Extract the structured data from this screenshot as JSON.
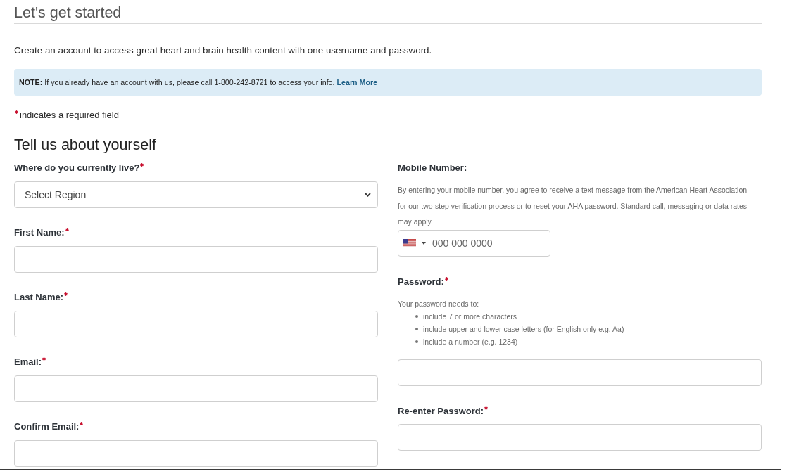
{
  "header": {
    "title": "Let's get started"
  },
  "intro": "Create an account to access great heart and brain health content with one username and password.",
  "note": {
    "text": "**NOTE:** If you already have an account with us, please call 1-800-242-8721 to access your info.",
    "link": "Learn More"
  },
  "required_legend": "indicates a required field",
  "section": {
    "title": "Tell us about yourself",
    "left_fields": [
      {
        "kind": "select",
        "label": "Where do you currently live?",
        "required": true,
        "value": "Select Region"
      },
      {
        "kind": "text",
        "label": "First Name:",
        "required": true
      },
      {
        "kind": "text",
        "label": "Last Name:",
        "required": true
      },
      {
        "kind": "text",
        "label": "Email:",
        "required": true
      },
      {
        "kind": "text",
        "label": "Confirm Email:",
        "required": true
      }
    ],
    "right_fields": [
      {
        "kind": "phone",
        "label": "Mobile Number:",
        "required": false,
        "help": "By entering your mobile number, you agree to receive a text message from the American Heart Association for our two-step verification process or to reset your AHA password. Standard call, messaging or data rates may apply.",
        "placeholder": "000 000 0000"
      },
      {
        "kind": "password",
        "label": "Password:",
        "required": true,
        "help": "Your password needs to:",
        "rules": [
          "include 7 or more characters",
          "include upper and lower case letters (for English only e.g. Aa)",
          "include a number (e.g. 1234)"
        ]
      },
      {
        "kind": "password",
        "label": "Re-enter Password:",
        "required": true
      }
    ]
  }
}
